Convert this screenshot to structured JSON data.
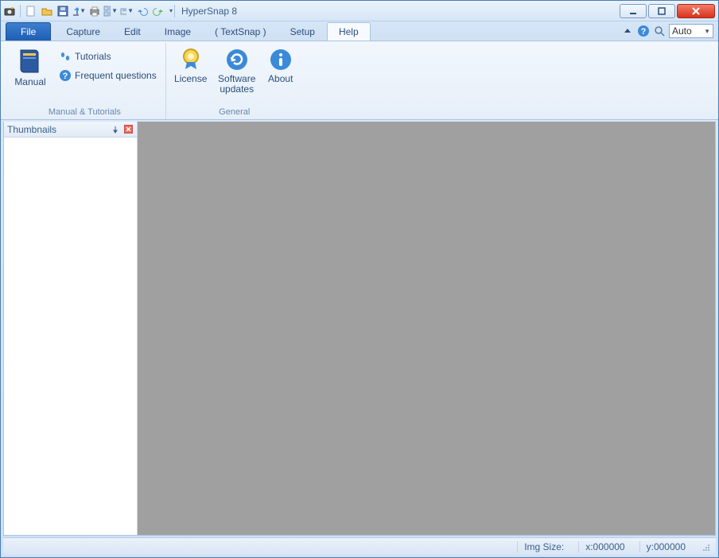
{
  "app": {
    "title": "HyperSnap 8"
  },
  "qat_icons": [
    "camera-icon",
    "new-icon",
    "open-icon",
    "save-icon",
    "upload-icon",
    "print-icon",
    "thumbnails-icon",
    "scanner-icon",
    "undo-icon",
    "redo-icon"
  ],
  "tabs": {
    "file": "File",
    "items": [
      "Capture",
      "Edit",
      "Image",
      "( TextSnap )",
      "Setup",
      "Help"
    ],
    "active_index": 5
  },
  "zoom": {
    "value": "Auto"
  },
  "ribbon": {
    "group1": {
      "label": "Manual & Tutorials",
      "manual": "Manual",
      "tutorials": "Tutorials",
      "faq": "Frequent questions"
    },
    "group2": {
      "label": "General",
      "license": "License",
      "updates_line1": "Software",
      "updates_line2": "updates",
      "about": "About"
    }
  },
  "panels": {
    "thumbnails": "Thumbnails"
  },
  "status": {
    "imgsize": "Img Size:",
    "x": "x:000000",
    "y": "y:000000"
  }
}
